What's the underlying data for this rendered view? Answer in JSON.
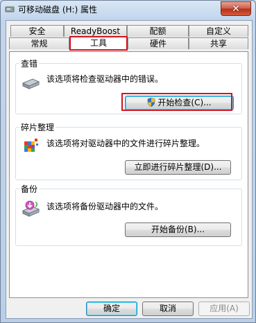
{
  "window": {
    "title": "可移动磁盘 (H:) 属性",
    "close_label": "✕"
  },
  "tabs": {
    "row1": [
      "安全",
      "ReadyBoost",
      "配额",
      "自定义"
    ],
    "row2": [
      "常规",
      "工具",
      "硬件",
      "共享"
    ],
    "active": "工具"
  },
  "groups": {
    "check": {
      "title": "查错",
      "text": "该选项将检查驱动器中的错误。",
      "button": "开始检查(C)...",
      "icon": "drive-icon"
    },
    "defrag": {
      "title": "碎片整理",
      "text": "该选项将对驱动器中的文件进行碎片整理。",
      "button": "立即进行碎片整理(D)...",
      "icon": "defrag-icon"
    },
    "backup": {
      "title": "备份",
      "text": "该选项将备份驱动器中的文件。",
      "button": "开始备份(B)...",
      "icon": "backup-icon"
    }
  },
  "footer": {
    "ok": "确定",
    "cancel": "取消",
    "apply": "应用(A)"
  },
  "colors": {
    "highlight": "#d2141e",
    "title_bg": "#c9dbef"
  }
}
